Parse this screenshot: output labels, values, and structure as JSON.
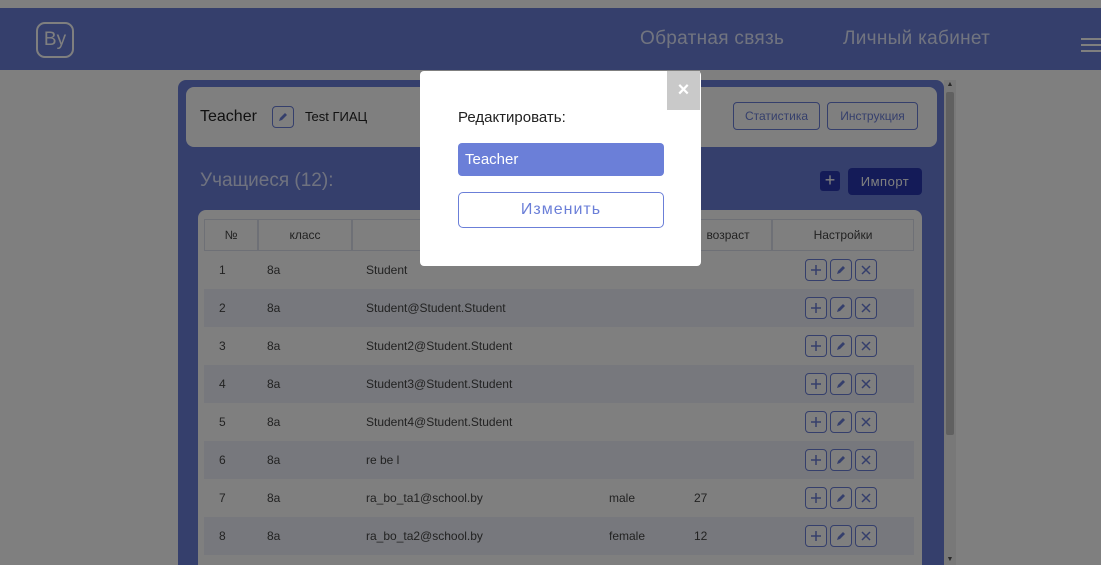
{
  "header": {
    "logo": "By",
    "nav_feedback": "Обратная связь",
    "nav_cabinet": "Личный кабинет"
  },
  "top": {
    "role": "Teacher",
    "school": "Test ГИАЦ",
    "stats_button": "Статистика",
    "instruction_button": "Инструкция"
  },
  "students": {
    "title": "Учащиеся (12):",
    "add_symbol": "+",
    "import_button": "Импорт"
  },
  "table": {
    "headers": [
      "№",
      "класс",
      "",
      "",
      "возраст",
      "Настройки"
    ],
    "rows": [
      {
        "num": "1",
        "class": "8а",
        "name": "Student",
        "sex": "",
        "age": ""
      },
      {
        "num": "2",
        "class": "8а",
        "name": "Student@Student.Student",
        "sex": "",
        "age": ""
      },
      {
        "num": "3",
        "class": "8а",
        "name": "Student2@Student.Student",
        "sex": "",
        "age": ""
      },
      {
        "num": "4",
        "class": "8а",
        "name": "Student3@Student.Student",
        "sex": "",
        "age": ""
      },
      {
        "num": "5",
        "class": "8а",
        "name": "Student4@Student.Student",
        "sex": "",
        "age": ""
      },
      {
        "num": "6",
        "class": "8а",
        "name": "re be l",
        "sex": "",
        "age": ""
      },
      {
        "num": "7",
        "class": "8а",
        "name": "ra_bo_ta1@school.by",
        "sex": "male",
        "age": "27"
      },
      {
        "num": "8",
        "class": "8а",
        "name": "ra_bo_ta2@school.by",
        "sex": "female",
        "age": "12"
      }
    ]
  },
  "modal": {
    "close": "×",
    "title": "Редактировать:",
    "input_value": "Teacher",
    "submit": "Изменить"
  },
  "colors": {
    "accent": "#6b7fd8",
    "dark_accent": "#2837b0"
  }
}
